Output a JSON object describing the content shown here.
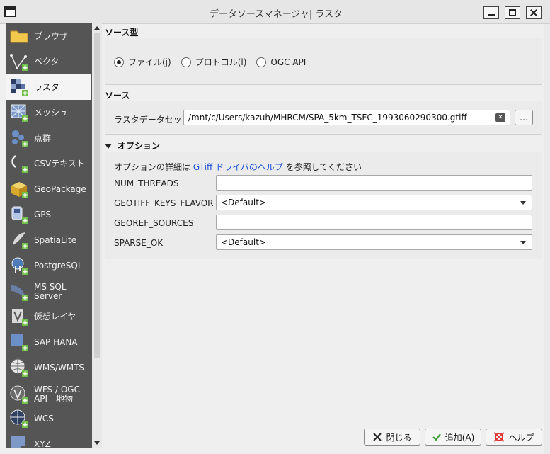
{
  "window": {
    "title": "データソースマネージャ| ラスタ"
  },
  "sidebar": {
    "items": [
      {
        "label": "ブラウザ",
        "icon": "folder-icon"
      },
      {
        "label": "ベクタ",
        "icon": "vector-icon"
      },
      {
        "label": "ラスタ",
        "icon": "raster-icon"
      },
      {
        "label": "メッシュ",
        "icon": "mesh-icon"
      },
      {
        "label": "点群",
        "icon": "point-cloud-icon"
      },
      {
        "label": "CSVテキスト",
        "icon": "csv-icon"
      },
      {
        "label": "GeoPackage",
        "icon": "geopackage-icon"
      },
      {
        "label": "GPS",
        "icon": "gps-icon"
      },
      {
        "label": "SpatiaLite",
        "icon": "spatialite-icon"
      },
      {
        "label": "PostgreSQL",
        "icon": "postgresql-icon"
      },
      {
        "label": "MS SQL Server",
        "icon": "mssql-icon"
      },
      {
        "label": "仮想レイヤ",
        "icon": "virtual-layer-icon"
      },
      {
        "label": "SAP HANA",
        "icon": "sap-hana-icon"
      },
      {
        "label": "WMS/WMTS",
        "icon": "wms-icon"
      },
      {
        "label": "WFS / OGC API - 地物",
        "icon": "wfs-icon"
      },
      {
        "label": "WCS",
        "icon": "wcs-icon"
      },
      {
        "label": "XYZ",
        "icon": "xyz-icon"
      }
    ]
  },
  "source_type": {
    "title": "ソース型",
    "options": [
      "ファイル(j)",
      "プロトコル(l)",
      "OGC API"
    ]
  },
  "source": {
    "title": "ソース",
    "label": "ラスタデータセット",
    "value": "/mnt/c/Users/kazuh/MHRCM/SPA_5km_TSFC_1993060290300.gtiff",
    "browse_label": "…"
  },
  "options": {
    "title": "オプション",
    "help_prefix": "オプションの詳細は",
    "help_link": "GTiff ドライバのヘルプ",
    "help_suffix": "を参照してください",
    "rows": [
      {
        "label": "NUM_THREADS",
        "value": ""
      },
      {
        "label": "GEOTIFF_KEYS_FLAVOR",
        "value": "<Default>"
      },
      {
        "label": "GEOREF_SOURCES",
        "value": ""
      },
      {
        "label": "SPARSE_OK",
        "value": "<Default>"
      }
    ]
  },
  "buttons": {
    "close": "閉じる",
    "add": "追加(A)",
    "help": "ヘルプ"
  }
}
